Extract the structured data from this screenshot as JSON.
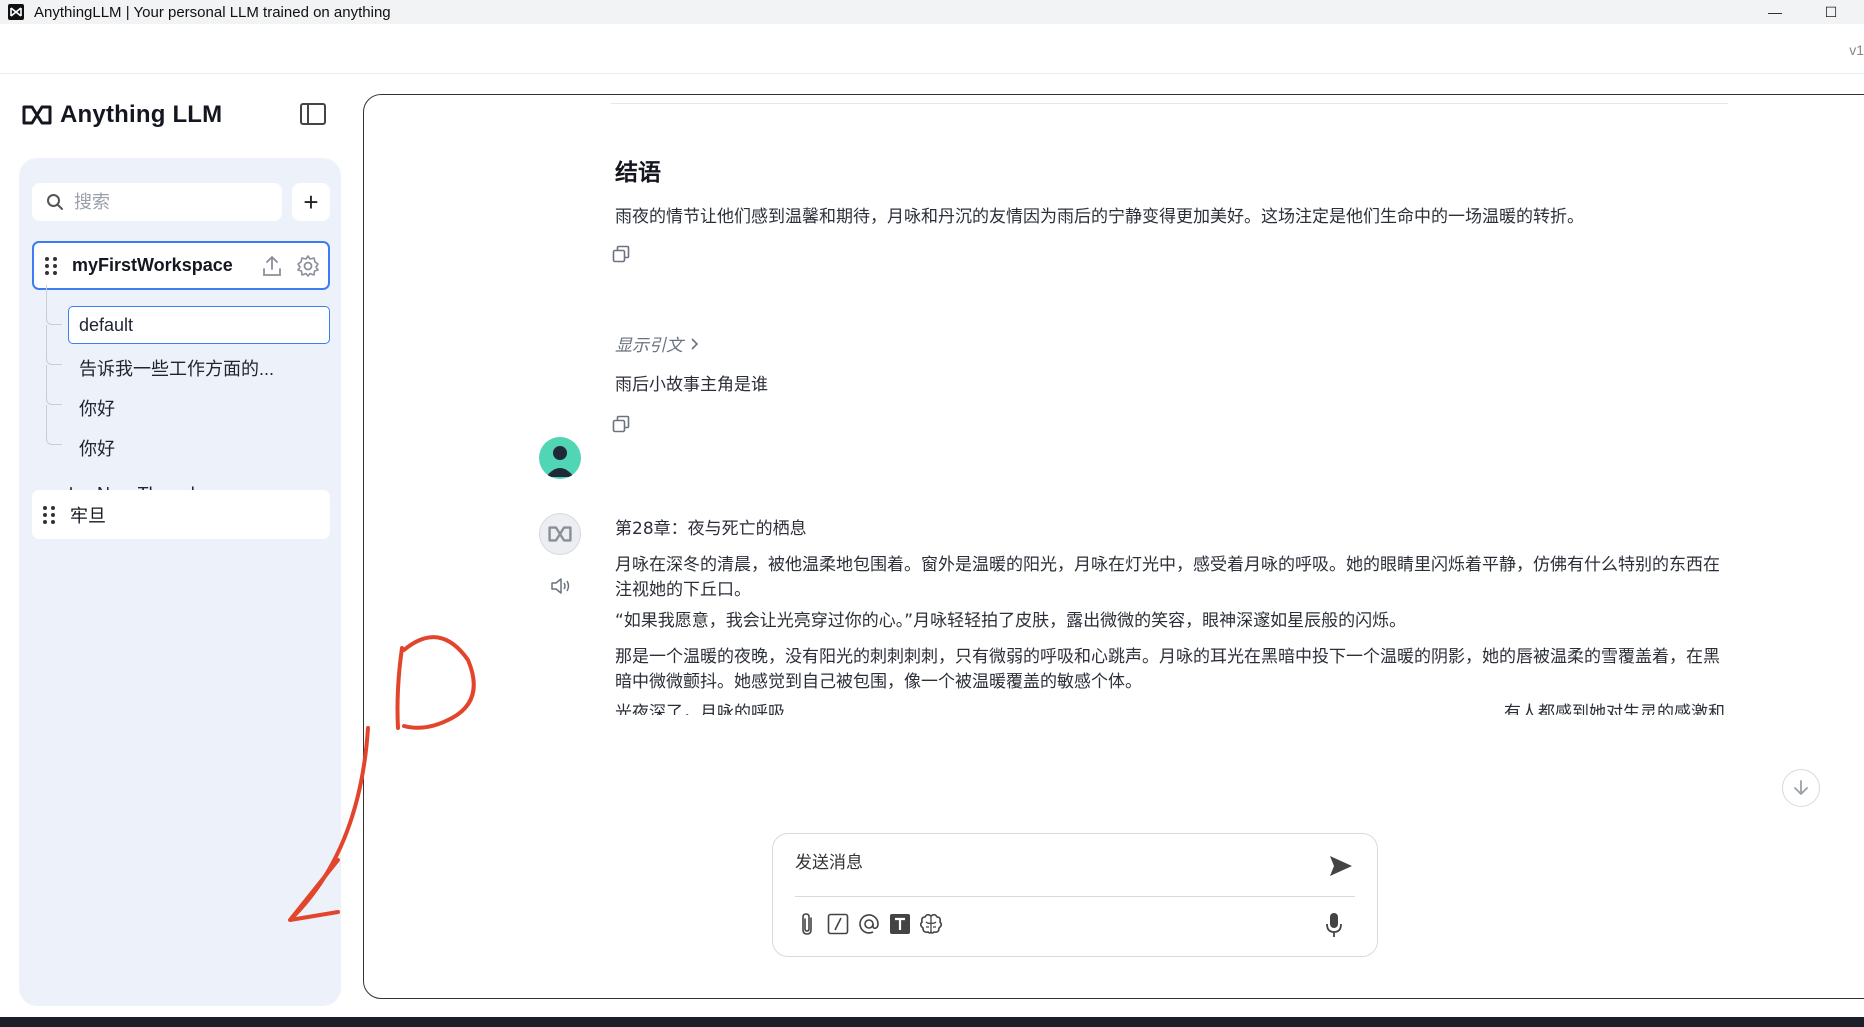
{
  "window": {
    "title": "AnythingLLM | Your personal LLM trained on anything",
    "minimize": "—",
    "maximize": "☐"
  },
  "topbar": {
    "version": "v1"
  },
  "sidebar": {
    "logo_text": "Anything LLM",
    "search_placeholder": "搜索",
    "add_workspace": "+",
    "workspaces": [
      {
        "name": "myFirstWorkspace"
      },
      {
        "name": "牢旦"
      }
    ],
    "threads": [
      {
        "label": "default"
      },
      {
        "label": "告诉我一些工作方面的..."
      },
      {
        "label": "你好"
      },
      {
        "label": "你好"
      }
    ],
    "new_thread": {
      "icon": "+",
      "label": "New Thread"
    },
    "footer_icons": [
      "support-icon",
      "docs-icon",
      "discord-icon",
      "settings-wrench-icon"
    ]
  },
  "chat": {
    "heading": "结语",
    "closing_paragraph": "雨夜的情节让他们感到温馨和期待，月咏和丹沉的友情因为雨后的宁静变得更加美好。这场注定是他们生命中的一场温暖的转折。",
    "show_citations": "显示引文",
    "user_message": "雨后小故事主角是谁",
    "bot_title": "第28章：夜与死亡的栖息",
    "bot_paragraphs": [
      "月咏在深冬的清晨，被他温柔地包围着。窗外是温暖的阳光，月咏在灯光中，感受着月咏的呼吸。她的眼睛里闪烁着平静，仿佛有什么特别的东西在注视她的下丘口。",
      "“如果我愿意，我会让光亮穿过你的心。”月咏轻轻拍了皮肤，露出微微的笑容，眼神深邃如星辰般的闪烁。",
      "那是一个温暖的夜晚，没有阳光的刺刺刺刺，只有微弱的呼吸和心跳声。月咏的耳光在黑暗中投下一个温暖的阴影，她的唇被温柔的雪覆盖着，在黑暗中微微颤抖。她感觉到自己被包围，像一个被温暖覆盖的敏感个体。",
      "光夜深了，月咏的呼吸",
      "有人都感到她对生灵的感激和"
    ]
  },
  "composer": {
    "placeholder": "发送消息",
    "tools": [
      "attach-icon",
      "slash-command-icon",
      "at-mention-icon",
      "text-format-icon",
      "agent-brain-icon"
    ]
  },
  "annotation": {
    "color": "#e2452c",
    "label": "①"
  }
}
